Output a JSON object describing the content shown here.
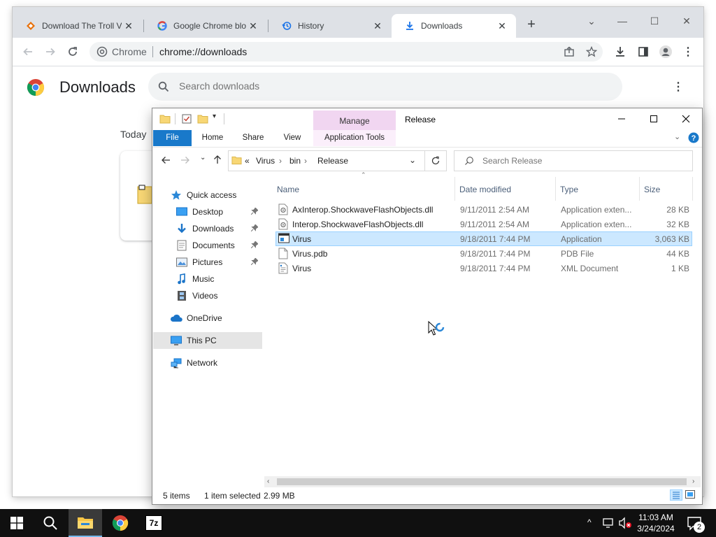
{
  "browser": {
    "tabs": [
      {
        "title": "Download The Troll V",
        "icon": "troll-favicon"
      },
      {
        "title": "Google Chrome bloc",
        "icon": "google-favicon"
      },
      {
        "title": "History",
        "icon": "history-icon"
      },
      {
        "title": "Downloads",
        "icon": "download-icon",
        "active": true
      }
    ],
    "new_tab_label": "+",
    "origin_chip": "Chrome",
    "url": "chrome://downloads",
    "page": {
      "title": "Downloads",
      "search_placeholder": "Search downloads",
      "today_label": "Today"
    }
  },
  "explorer": {
    "title": "Release",
    "contextual_tab": "Manage",
    "ribbon_tabs": [
      "File",
      "Home",
      "Share",
      "View",
      "Application Tools"
    ],
    "breadcrumb": {
      "overflow": "«",
      "parts": [
        "Virus",
        "bin",
        "Release"
      ]
    },
    "search_placeholder": "Search Release",
    "nav": {
      "quick_access": "Quick access",
      "items": [
        "Desktop",
        "Downloads",
        "Documents",
        "Pictures",
        "Music",
        "Videos"
      ],
      "onedrive": "OneDrive",
      "this_pc": "This PC",
      "network": "Network"
    },
    "columns": [
      "Name",
      "Date modified",
      "Type",
      "Size"
    ],
    "files": [
      {
        "name": "AxInterop.ShockwaveFlashObjects.dll",
        "date": "9/11/2011 2:54 AM",
        "type": "Application exten...",
        "size": "28 KB",
        "icon": "dll-file-icon"
      },
      {
        "name": "Interop.ShockwaveFlashObjects.dll",
        "date": "9/11/2011 2:54 AM",
        "type": "Application exten...",
        "size": "32 KB",
        "icon": "dll-file-icon"
      },
      {
        "name": "Virus",
        "date": "9/18/2011 7:44 PM",
        "type": "Application",
        "size": "3,063 KB",
        "icon": "application-exe-icon",
        "selected": true
      },
      {
        "name": "Virus.pdb",
        "date": "9/18/2011 7:44 PM",
        "type": "PDB File",
        "size": "44 KB",
        "icon": "pdb-file-icon"
      },
      {
        "name": "Virus",
        "date": "9/18/2011 7:44 PM",
        "type": "XML Document",
        "size": "1 KB",
        "icon": "xml-file-icon"
      }
    ],
    "status": {
      "items": "5 items",
      "selected": "1 item selected",
      "size": "2.99 MB"
    }
  },
  "taskbar": {
    "time": "11:03 AM",
    "date": "3/24/2024",
    "notification_count": "2",
    "apps": [
      "file-explorer",
      "google-chrome",
      "7-zip"
    ],
    "seven_zip_label": "7z"
  },
  "colors": {
    "accent": "#1979ca",
    "selection": "#cce8ff",
    "manage": "#f1d6f1"
  }
}
